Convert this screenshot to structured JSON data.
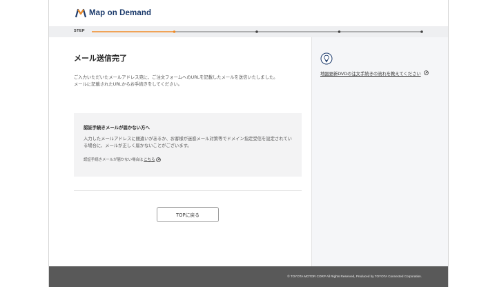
{
  "header": {
    "brand_name": "Map on Demand",
    "brand_colors": {
      "navy": "#1b3a6b",
      "orange": "#f08a24"
    }
  },
  "stepper": {
    "label": "STEP",
    "total_steps": 4,
    "current_step": 1,
    "progress_color": "#f08a24",
    "track_color": "#444444"
  },
  "main": {
    "title": "メール送信完了",
    "description_line1": "ご入力いただいたメールアドレス宛に、ご注文フォームへのURLを記載したメールを送信いたしました。",
    "description_line2": "メールに記載されたURLからお手続きをしてください。",
    "notice": {
      "title": "認証手続きメールが届かない方へ",
      "body": "入力したメールアドレスに間違いがあるか、お客様が迷惑メール対策等でドメイン指定受信を設定されている場合に、メールが正しく届かないことがございます。",
      "link_prefix": "認証手続きメールが届かない場合は",
      "link_label": "こちら",
      "link_icon": "external-link-icon"
    },
    "top_button_label": "TOPに戻る"
  },
  "sidebar": {
    "icon": "lightbulb-icon",
    "link_label": "地図更新DVDの注文手続きの流れを教えてください",
    "link_icon": "external-link-icon"
  },
  "footer": {
    "copyright": "© TOYOTA MOTOR CORP All Rights Reserved, Produced by TOYOTA Connected Corporation."
  }
}
